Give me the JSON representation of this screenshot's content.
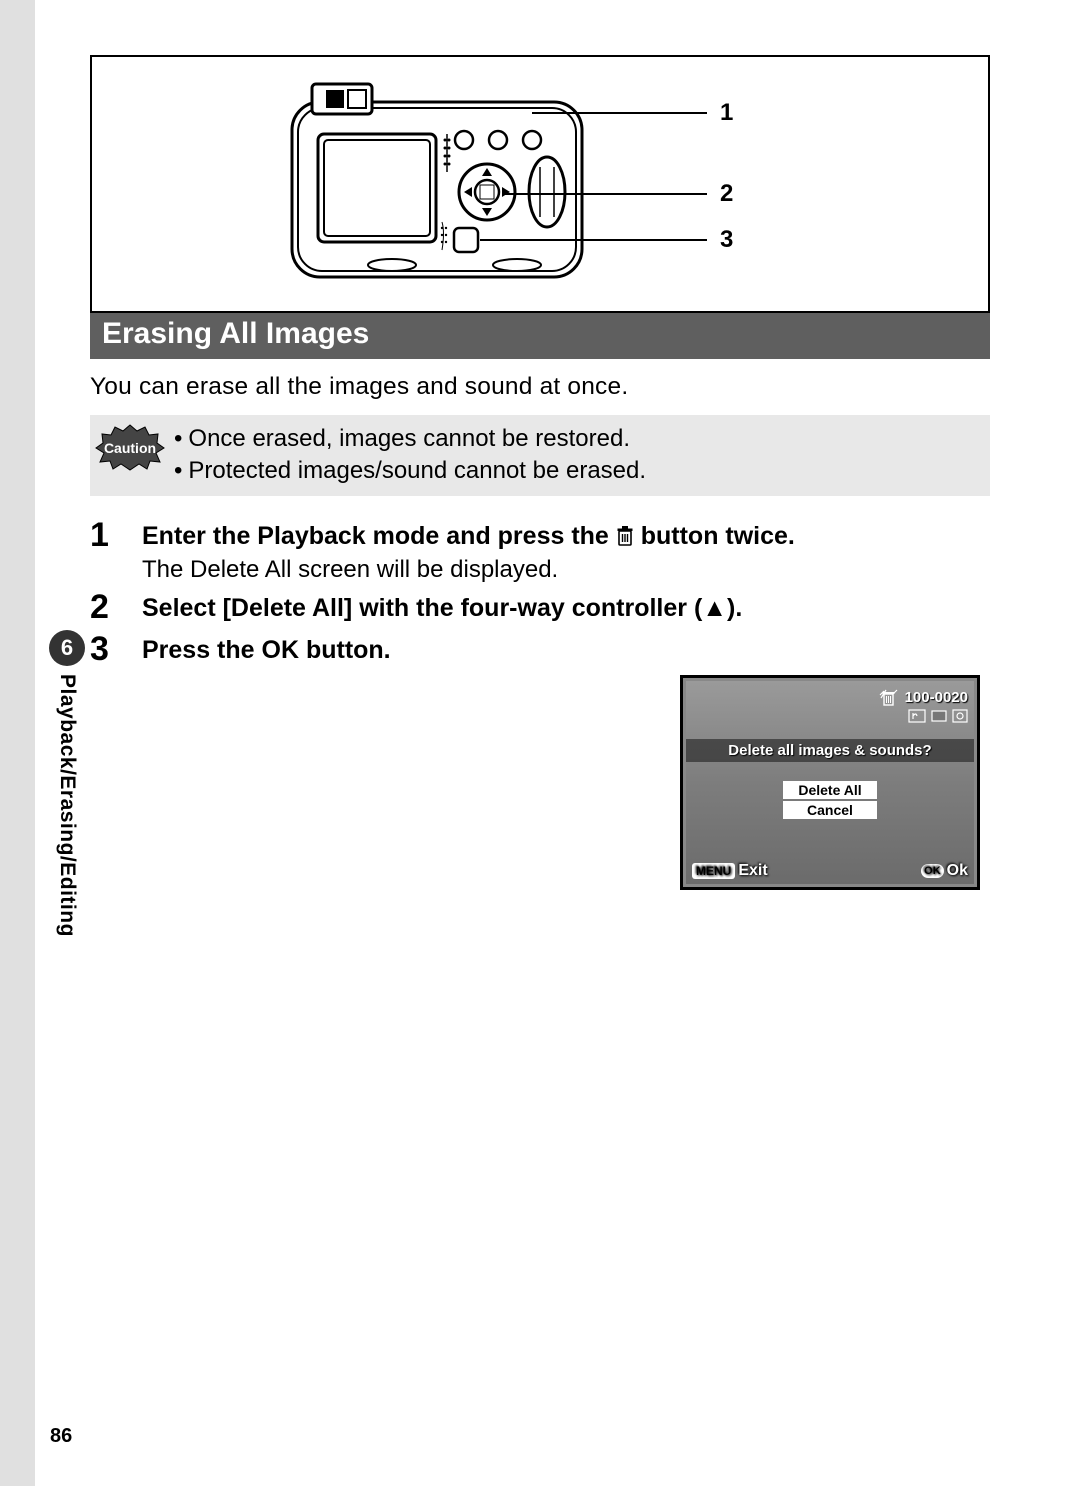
{
  "diagram": {
    "callouts": [
      "1",
      "2",
      "3"
    ]
  },
  "section_title": "Erasing All Images",
  "intro": "You can erase all the images and sound at once.",
  "caution_label": "Caution",
  "caution_items": [
    "Once erased, images cannot be restored.",
    "Protected images/sound cannot be erased."
  ],
  "steps": [
    {
      "num": "1",
      "title_pre": "Enter the Playback mode and press the ",
      "title_post": " button twice.",
      "desc": "The Delete All screen will be displayed."
    },
    {
      "num": "2",
      "title_pre": "Select [Delete All] with the four-way controller (",
      "title_post": ").",
      "desc": ""
    },
    {
      "num": "3",
      "title_pre": "Press the OK button.",
      "title_post": "",
      "desc": ""
    }
  ],
  "chapter": {
    "num": "6",
    "label": "Playback/Erasing/Editing"
  },
  "lcd": {
    "file_no": "100-0020",
    "question": "Delete all images & sounds?",
    "options": [
      "Delete All",
      "Cancel"
    ],
    "menu_label": "MENU",
    "exit_label": "Exit",
    "ok_badge": "OK",
    "ok_label": "Ok"
  },
  "page_number": "86"
}
